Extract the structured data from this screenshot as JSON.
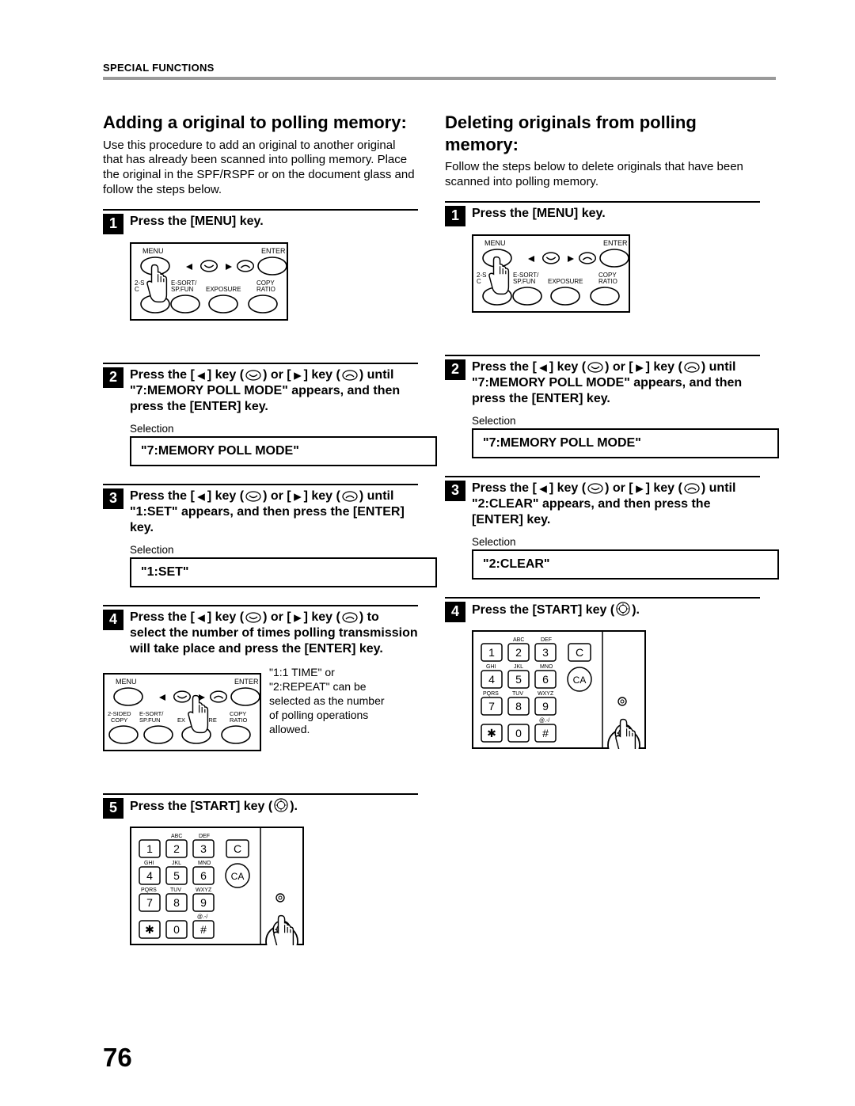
{
  "running_head": "SPECIAL FUNCTIONS",
  "page_number": "76",
  "left": {
    "title": "Adding a original to polling memory:",
    "intro": "Use this procedure to add an original to another original that has already been scanned into polling memory. Place the original in the SPF/RSPF or on the document glass and follow the steps below.",
    "steps": {
      "s1": {
        "num": "1",
        "title": "Press the [MENU] key."
      },
      "s2": {
        "num": "2",
        "pre": "Press the [",
        "mid1": "] key (",
        "mid2": ") or [",
        "mid3": "] key (",
        "post": ")",
        "rest": "until \"7:MEMORY POLL MODE\" appears, and then press the [ENTER] key.",
        "sel_label": "Selection",
        "lcd": "\"7:MEMORY POLL MODE\""
      },
      "s3": {
        "num": "3",
        "pre": "Press the [",
        "mid1": "] key (",
        "mid2": ") or [",
        "mid3": "] key (",
        "post": ")",
        "rest": "until \"1:SET\" appears, and then press the [ENTER] key.",
        "sel_label": "Selection",
        "lcd": "\"1:SET\""
      },
      "s4": {
        "num": "4",
        "pre": "Press the [",
        "mid1": "] key (",
        "mid2": ") or [",
        "mid3": "] key (",
        "post": ")",
        "rest": "to select the number of times polling transmission will take place and press the [ENTER] key.",
        "note": "\"1:1 TIME\" or \"2:REPEAT\" can be selected as the number of polling operations allowed."
      },
      "s5": {
        "num": "5",
        "pre": "Press the  [START] key (",
        "post": ")."
      }
    }
  },
  "right": {
    "title": "Deleting originals from polling memory:",
    "intro": "Follow the steps below to delete originals that have been scanned into polling memory.",
    "steps": {
      "s1": {
        "num": "1",
        "title": "Press the [MENU] key."
      },
      "s2": {
        "num": "2",
        "pre": "Press the [",
        "mid1": "] key (",
        "mid2": ") or [",
        "mid3": "] key (",
        "post": ")",
        "rest": "until \"7:MEMORY POLL MODE\" appears, and then press the [ENTER] key.",
        "sel_label": "Selection",
        "lcd": "\"7:MEMORY POLL MODE\""
      },
      "s3": {
        "num": "3",
        "pre": "Press the [",
        "mid1": "] key (",
        "mid2": ") or [",
        "mid3": "] key (",
        "post": ")",
        "rest": "until \"2:CLEAR\" appears, and then press the [ENTER] key.",
        "sel_label": "Selection",
        "lcd": "\"2:CLEAR\""
      },
      "s4": {
        "num": "4",
        "pre": "Press the  [START] key (",
        "post": ")."
      }
    }
  },
  "panel": {
    "menu": "MENU",
    "enter": "ENTER",
    "row": {
      "a": "2-SIDED",
      "b": "E-SORT/",
      "b2": "SP.FUN",
      "c": "EXPOSURE",
      "d": "COPY",
      "d2": "RATIO"
    },
    "row_alt": {
      "a": "2-S",
      "a2": "C",
      "b": "ED",
      "b1": "Y"
    },
    "row_clip": {
      "c": "EX",
      "c2": "URE"
    }
  },
  "keypad": {
    "abc": "ABC",
    "def": "DEF",
    "ghi": "GHI",
    "jkl": "JKL",
    "mno": "MNO",
    "pqrs": "PQRS",
    "tuv": "TUV",
    "wxyz": "WXYZ",
    "atmark": "@.-/",
    "k1": "1",
    "k2": "2",
    "k3": "3",
    "k4": "4",
    "k5": "5",
    "k6": "6",
    "k7": "7",
    "k8": "8",
    "k9": "9",
    "k0": "0",
    "star": "✱",
    "hash": "#",
    "C": "C",
    "CA": "CA"
  }
}
